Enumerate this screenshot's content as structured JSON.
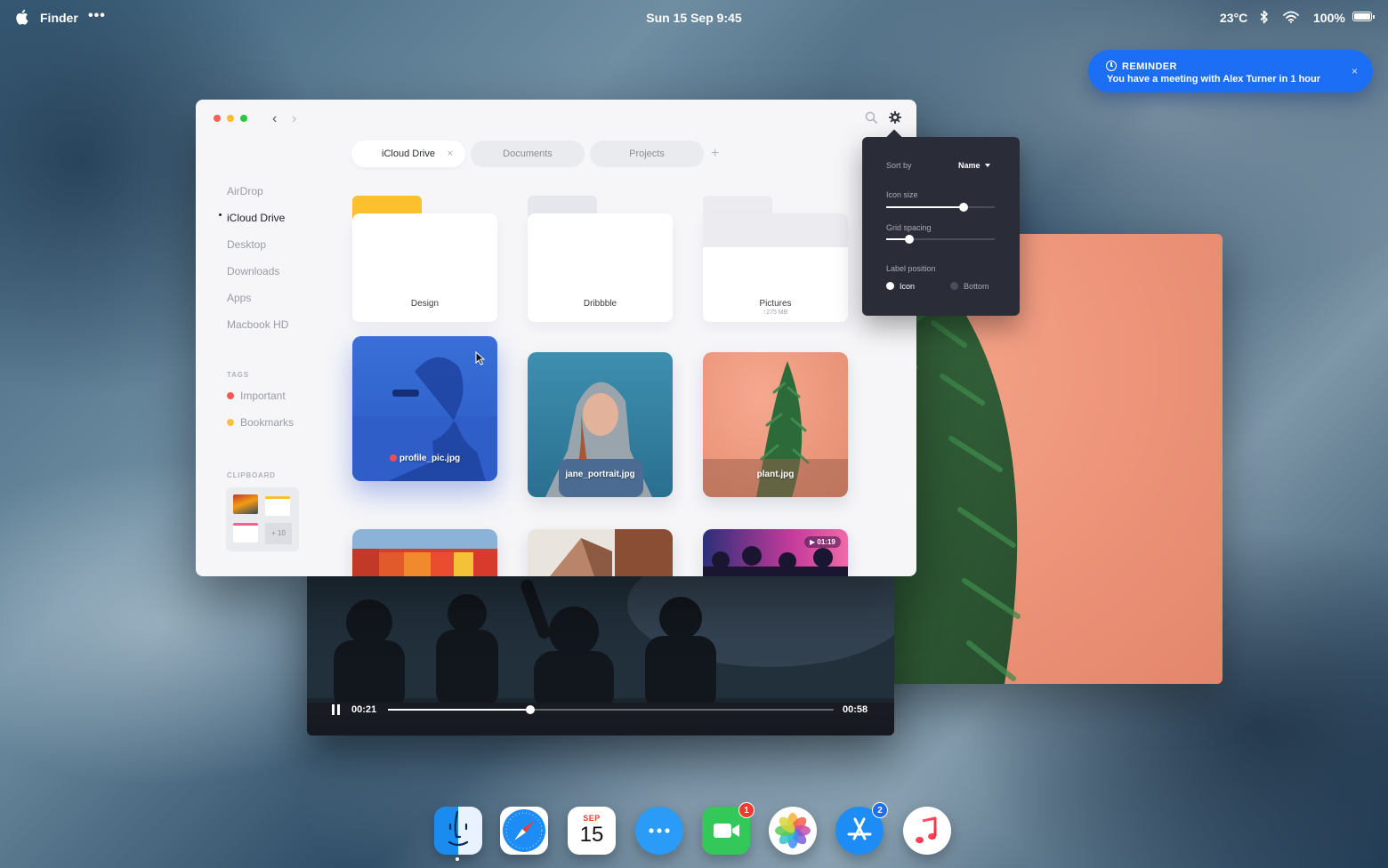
{
  "menubar": {
    "app_name": "Finder",
    "more": "•••",
    "datetime": "Sun 15 Sep 9:45",
    "temperature": "23°C",
    "battery": "100%",
    "battery_level": 1.0
  },
  "reminder": {
    "title": "REMINDER",
    "message": "You have a meeting with Alex Turner in 1 hour",
    "close": "×"
  },
  "finder": {
    "tabs": [
      {
        "label": "iCloud Drive",
        "active": true,
        "close": "×"
      },
      {
        "label": "Documents",
        "active": false
      },
      {
        "label": "Projects",
        "active": false
      }
    ],
    "add_tab": "+",
    "sidebar": {
      "items": [
        "AirDrop",
        "iCloud Drive",
        "Desktop",
        "Downloads",
        "Apps",
        "Macbook HD"
      ],
      "active_item": "iCloud Drive",
      "tags_heading": "TAGS",
      "tags": [
        {
          "label": "Important",
          "color": "#f25a4f"
        },
        {
          "label": "Bookmarks",
          "color": "#f6c143"
        }
      ],
      "clipboard_heading": "CLIPBOARD",
      "clipboard_more": "+ 10"
    },
    "folders": [
      {
        "label": "Design",
        "tab_color": "#fbc02d",
        "size": ""
      },
      {
        "label": "Dribbble",
        "tab_color": "#e6e7ec",
        "size": ""
      },
      {
        "label": "Pictures",
        "tab_color": "#ececf0",
        "size": "↑275 MB"
      }
    ],
    "photos": [
      {
        "label": "profile_pic.jpg",
        "selected": true
      },
      {
        "label": "jane_portrait.jpg"
      },
      {
        "label": "plant.jpg"
      }
    ],
    "video_duration": "01:19"
  },
  "settings": {
    "sort_by_label": "Sort by",
    "sort_by_value": "Name",
    "icon_size_label": "Icon size",
    "icon_size_value": 0.71,
    "grid_spacing_label": "Grid spacing",
    "grid_spacing_value": 0.21,
    "label_position_label": "Label position",
    "label_position_options": [
      "Icon",
      "Bottom"
    ],
    "label_position_selected": "Icon"
  },
  "video_player": {
    "current_time": "00:21",
    "total_time": "00:58",
    "progress": 0.32
  },
  "dock": {
    "calendar_month": "SEP",
    "calendar_day": "15",
    "facetime_badge": "1",
    "appstore_badge": "2"
  },
  "colors": {
    "accent_blue": "#1c6ef5",
    "popover_bg": "#2a2d38",
    "badge_red": "#f23b30"
  }
}
